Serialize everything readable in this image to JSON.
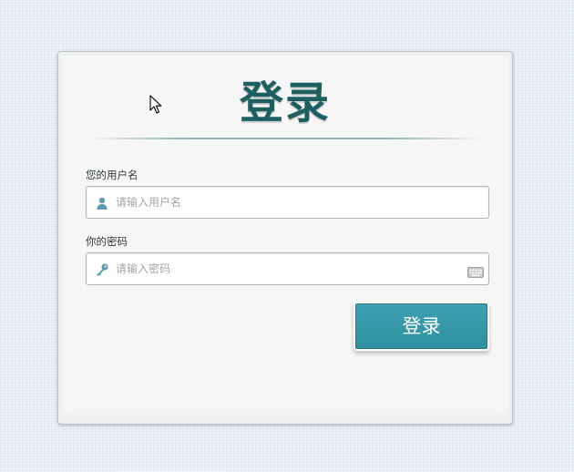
{
  "header": {
    "title": "登录"
  },
  "username": {
    "label": "您的用户名",
    "placeholder": "请输入用户名",
    "value": "",
    "icon": "user-icon"
  },
  "password": {
    "label": "你的密码",
    "placeholder": "请输入密码",
    "value": "",
    "icon": "key-icon",
    "trailing_icon": "keyboard-icon"
  },
  "actions": {
    "login_label": "登录"
  },
  "colors": {
    "accent": "#31909f",
    "title": "#1e5f60",
    "icon": "#5e9bb0",
    "background": "#e9eef6",
    "card": "#f6f6f6"
  }
}
